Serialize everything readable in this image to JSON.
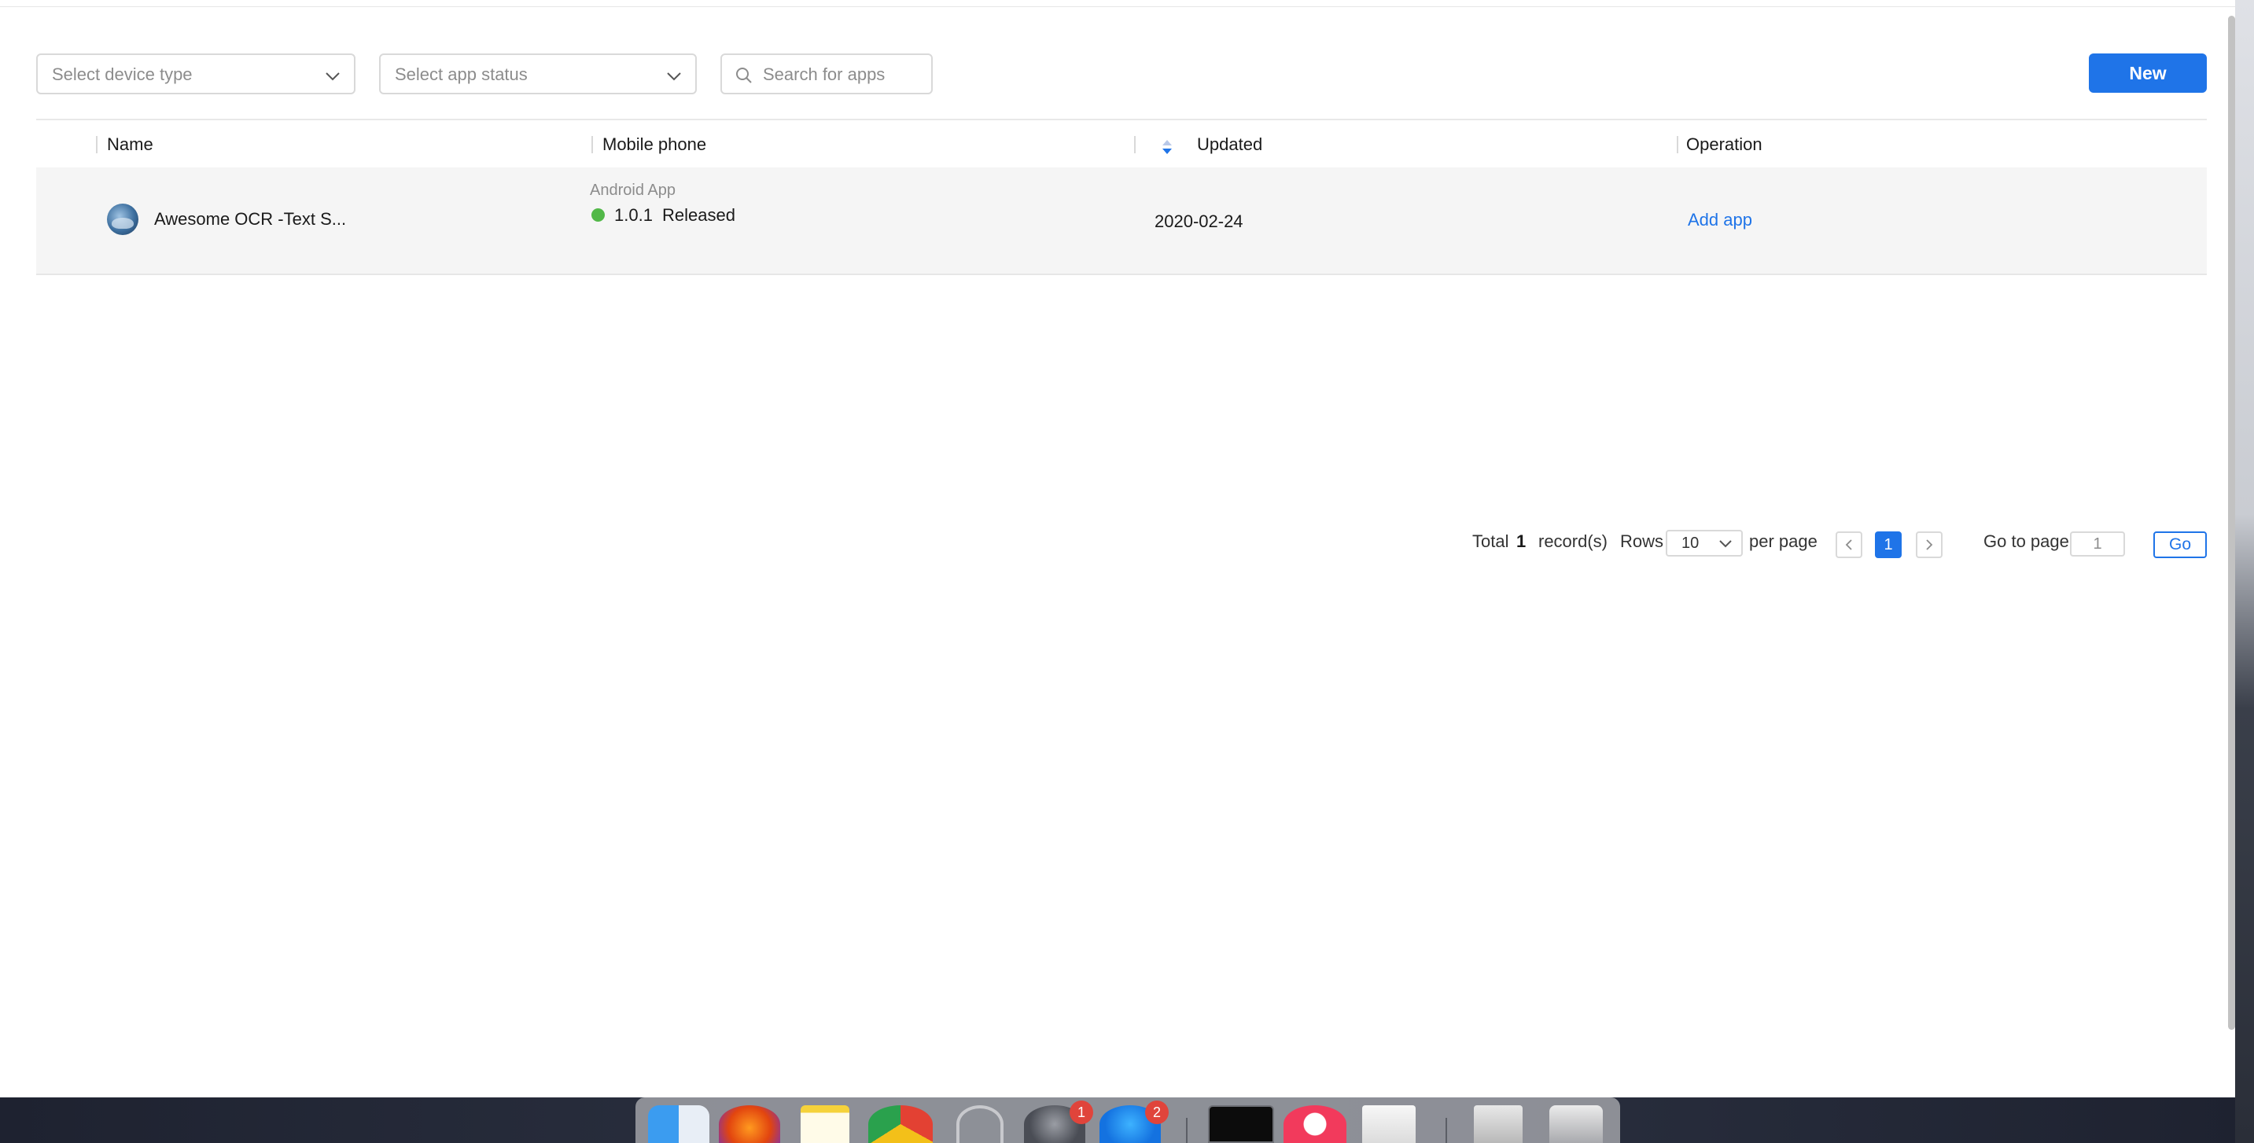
{
  "filters": {
    "device_type_placeholder": "Select device type",
    "app_status_placeholder": "Select app status",
    "search_placeholder": "Search for apps"
  },
  "toolbar": {
    "new_label": "New"
  },
  "table": {
    "columns": [
      "Name",
      "Mobile phone",
      "Updated",
      "Operation"
    ],
    "rows": [
      {
        "name": "Awesome OCR -Text S...",
        "platform": "Android App",
        "version": "1.0.1",
        "status": "Released",
        "status_color": "#52b848",
        "updated": "2020-02-24",
        "operation": "Add app"
      }
    ]
  },
  "pagination": {
    "total_label": "Total",
    "total_count": "1",
    "records_label": "record(s)",
    "rows_label": "Rows",
    "rows_value": "10",
    "per_page_label": "per page",
    "current_page": "1",
    "goto_label": "Go to page",
    "goto_value": "1",
    "go_label": "Go"
  },
  "dock": {
    "icons": [
      "finder-icon",
      "firefox-icon",
      "notes-icon",
      "chrome-icon",
      "help-icon",
      "system-preferences-icon",
      "app-store-icon",
      "terminal-icon",
      "music-icon",
      "textedit-icon",
      "documents-icon",
      "trash-icon"
    ],
    "badges": {
      "system_preferences": "1",
      "app_store": "2"
    }
  },
  "colors": {
    "accent": "#1f74e8",
    "released": "#52b848"
  }
}
